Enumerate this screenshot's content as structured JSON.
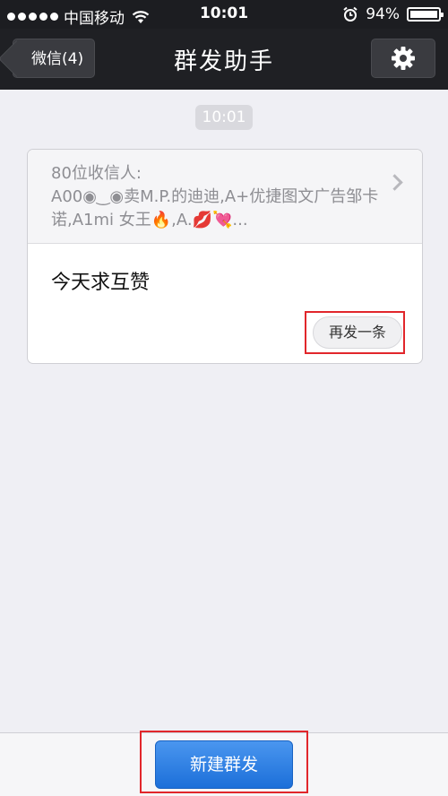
{
  "status_bar": {
    "carrier": "中国移动",
    "time": "10:01",
    "battery": "94%",
    "battery_level": 0.94
  },
  "nav": {
    "back_label": "微信(4)",
    "title": "群发助手"
  },
  "chat": {
    "time_chip": "10:01",
    "card": {
      "recipient_count": "80位收信人:",
      "recipient_names": "A00◉‿◉卖M.P.的迪迪,A+优捷图文广告邹卡诺,A1mi 女王🔥,A.💋💘...",
      "message": "今天求互赞",
      "resend_label": "再发一条"
    }
  },
  "bottom": {
    "new_broadcast_label": "新建群发"
  },
  "colors": {
    "accent_blue": "#1c6fd9",
    "highlight_red": "#e1262b",
    "nav_bg": "#1f2024"
  }
}
